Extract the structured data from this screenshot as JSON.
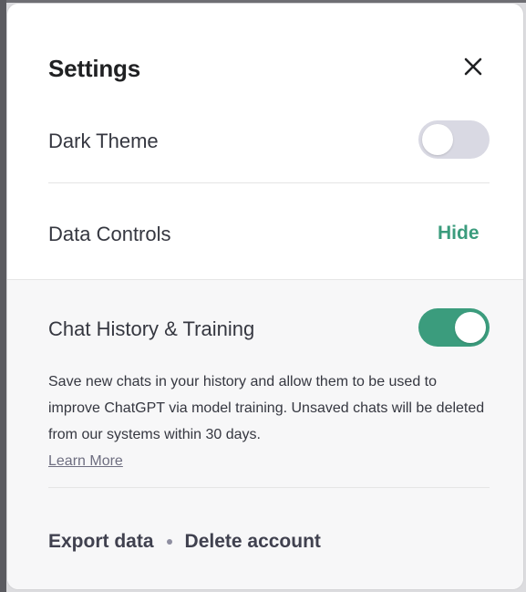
{
  "settings": {
    "title": "Settings",
    "close_icon": "close-icon",
    "dark_theme": {
      "label": "Dark Theme",
      "enabled": false
    },
    "data_controls": {
      "label": "Data Controls",
      "toggle_label": "Hide"
    },
    "chat_history": {
      "label": "Chat History & Training",
      "enabled": true,
      "description": "Save new chats in your history and allow them to be used to improve ChatGPT via model training. Unsaved chats will be deleted from our systems within 30 days.",
      "learn_more": "Learn More"
    },
    "footer": {
      "export_label": "Export data",
      "separator": "•",
      "delete_label": "Delete account"
    }
  },
  "colors": {
    "accent": "#3b9c7d",
    "toggle_on": "#3b9c7d",
    "toggle_off": "#d9d9e3",
    "text_primary": "#202123",
    "text_body": "#353740",
    "section_bg": "#f7f7f8"
  }
}
